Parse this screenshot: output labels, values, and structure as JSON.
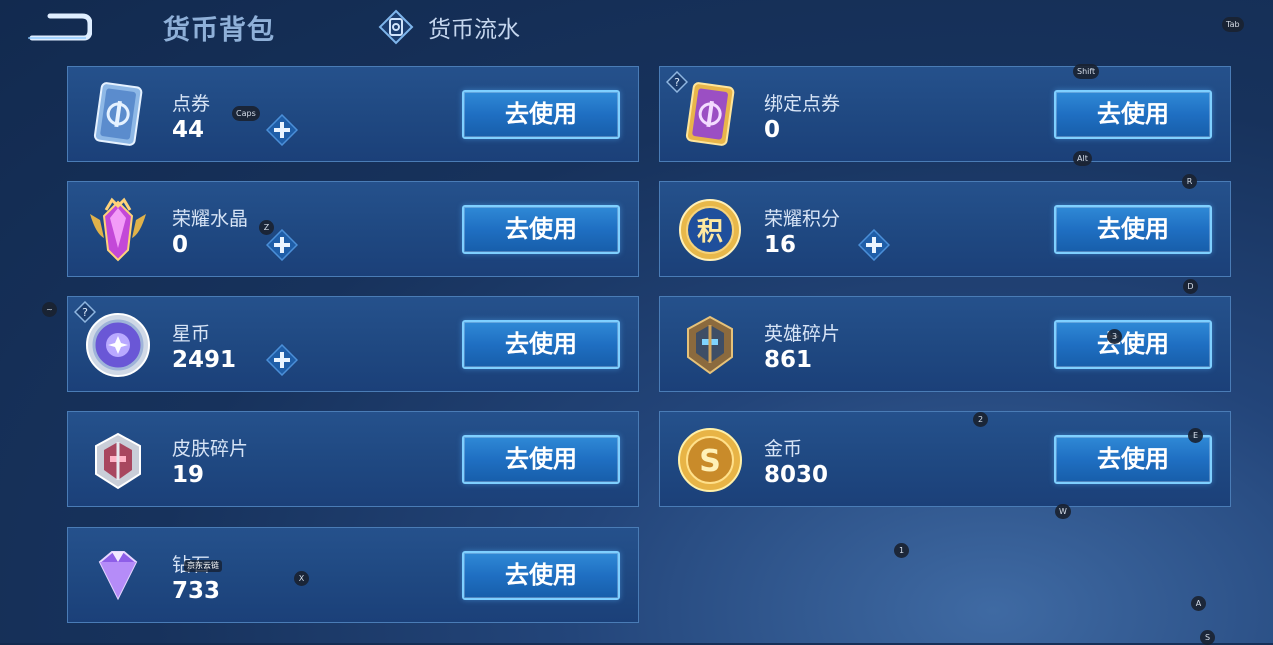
{
  "header": {
    "title": "货币背包",
    "flow_tab": "货币流水"
  },
  "action_label": "去使用",
  "cards": [
    {
      "name": "点券",
      "amount": "44",
      "icon": "coupon-card-icon"
    },
    {
      "name": "绑定点券",
      "amount": "0",
      "icon": "bound-coupon-card-icon"
    },
    {
      "name": "荣耀水晶",
      "amount": "0",
      "icon": "glory-crystal-icon"
    },
    {
      "name": "荣耀积分",
      "amount": "16",
      "icon": "glory-points-icon"
    },
    {
      "name": "星币",
      "amount": "2491",
      "icon": "star-coin-icon"
    },
    {
      "name": "英雄碎片",
      "amount": "861",
      "icon": "hero-fragment-icon"
    },
    {
      "name": "皮肤碎片",
      "amount": "19",
      "icon": "skin-fragment-icon"
    },
    {
      "name": "金币",
      "amount": "8030",
      "icon": "gold-coin-icon"
    },
    {
      "name": "钻石",
      "amount": "733",
      "icon": "diamond-icon"
    }
  ],
  "overlay": {
    "tooltip_text": "京东云链",
    "keys": [
      "Tab",
      "Shift",
      "Alt",
      "Caps",
      "R",
      "Z",
      "D",
      "3",
      "2",
      "E",
      "W",
      "1",
      "X",
      "A",
      "S",
      "~"
    ]
  },
  "colors": {
    "accent": "#2f89d6",
    "panel": "#1f4881",
    "border": "#4a7cb6"
  }
}
